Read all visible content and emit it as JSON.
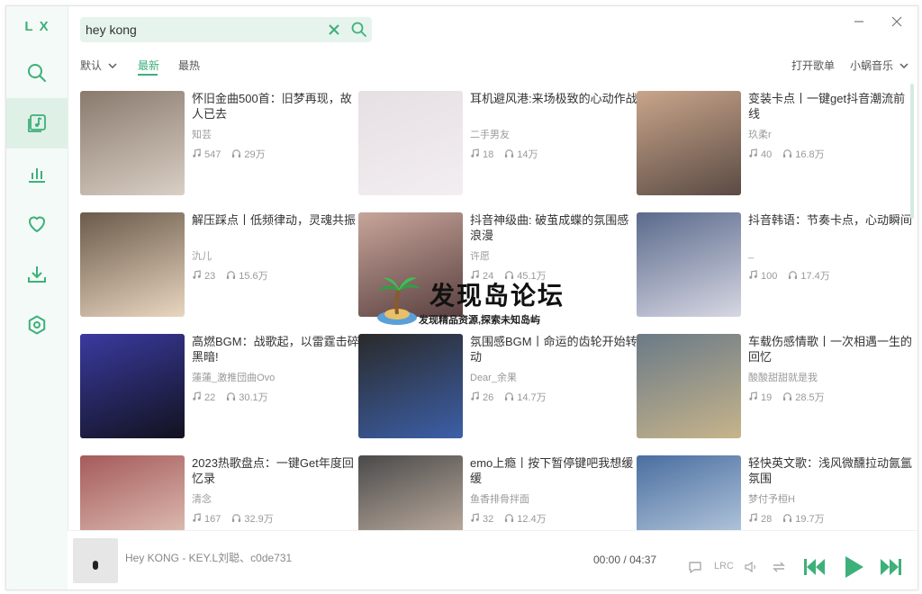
{
  "app": {
    "logo": "LX"
  },
  "sidebar": {
    "items": [
      {
        "name": "search",
        "icon": "search-icon"
      },
      {
        "name": "songlist",
        "icon": "music-list-icon",
        "active": true
      },
      {
        "name": "leaderboard",
        "icon": "chart-icon"
      },
      {
        "name": "favorites",
        "icon": "heart-icon"
      },
      {
        "name": "download",
        "icon": "download-icon"
      },
      {
        "name": "settings",
        "icon": "settings-icon"
      }
    ]
  },
  "search": {
    "value": "hey kong",
    "placeholder": ""
  },
  "filters": {
    "sort": "默认",
    "tab_latest": "最新",
    "tab_hottest": "最热",
    "open_songlist": "打开歌单",
    "source": "小蜗音乐"
  },
  "playlists": [
    {
      "title": "怀旧金曲500首：旧梦再现，故人已去",
      "author": "知芸",
      "songs": "547",
      "plays": "29万"
    },
    {
      "title": "耳机避风港:来场极致的心动作战",
      "author": "二手男友",
      "songs": "18",
      "plays": "14万"
    },
    {
      "title": "变装卡点丨一键get抖音潮流前线",
      "author": "玖柔r",
      "songs": "40",
      "plays": "16.8万"
    },
    {
      "title": "解压踩点丨低频律动，灵魂共振",
      "author": "氿儿",
      "songs": "23",
      "plays": "15.6万"
    },
    {
      "title": "抖音神级曲: 破茧成蝶的氛围感浪漫",
      "author": "许愿",
      "songs": "24",
      "plays": "45.1万"
    },
    {
      "title": "抖音韩语：节奏卡点，心动瞬间",
      "author": "_",
      "songs": "100",
      "plays": "17.4万"
    },
    {
      "title": "高燃BGM：战歌起，以雷霆击碎黑暗!",
      "author": "蓮蓮_激推団曲Ovo",
      "songs": "22",
      "plays": "30.1万"
    },
    {
      "title": "氛围感BGM丨命运的齿轮开始转动",
      "author": "Dear_余果",
      "songs": "26",
      "plays": "14.7万"
    },
    {
      "title": "车载伤感情歌丨一次相遇一生的回忆",
      "author": "酸酸甜甜就是我",
      "songs": "19",
      "plays": "28.5万"
    },
    {
      "title": "2023热歌盘点：一键Get年度回忆录",
      "author": "清念",
      "songs": "167",
      "plays": "32.9万"
    },
    {
      "title": "emo上瘾丨按下暂停键吧我想缓缓",
      "author": "鱼香排骨拌面",
      "songs": "32",
      "plays": "12.4万"
    },
    {
      "title": "轻快英文歌：浅风微醺拉动氤氲氛围",
      "author": "梦付予桓H",
      "songs": "28",
      "plays": "19.7万"
    }
  ],
  "player": {
    "title": "Hey KONG - KEY.L刘聪、c0de731",
    "current_time": "00:00",
    "separator": "/",
    "total_time": "04:37",
    "lrc": "LRC"
  },
  "watermark": {
    "title": "发现岛论坛",
    "subtitle": "发现精品资源,探索未知岛屿"
  },
  "colors": {
    "accent": "#3eb07a",
    "sidebar_bg": "#f4faf7",
    "search_bg": "#e6f4ed"
  }
}
